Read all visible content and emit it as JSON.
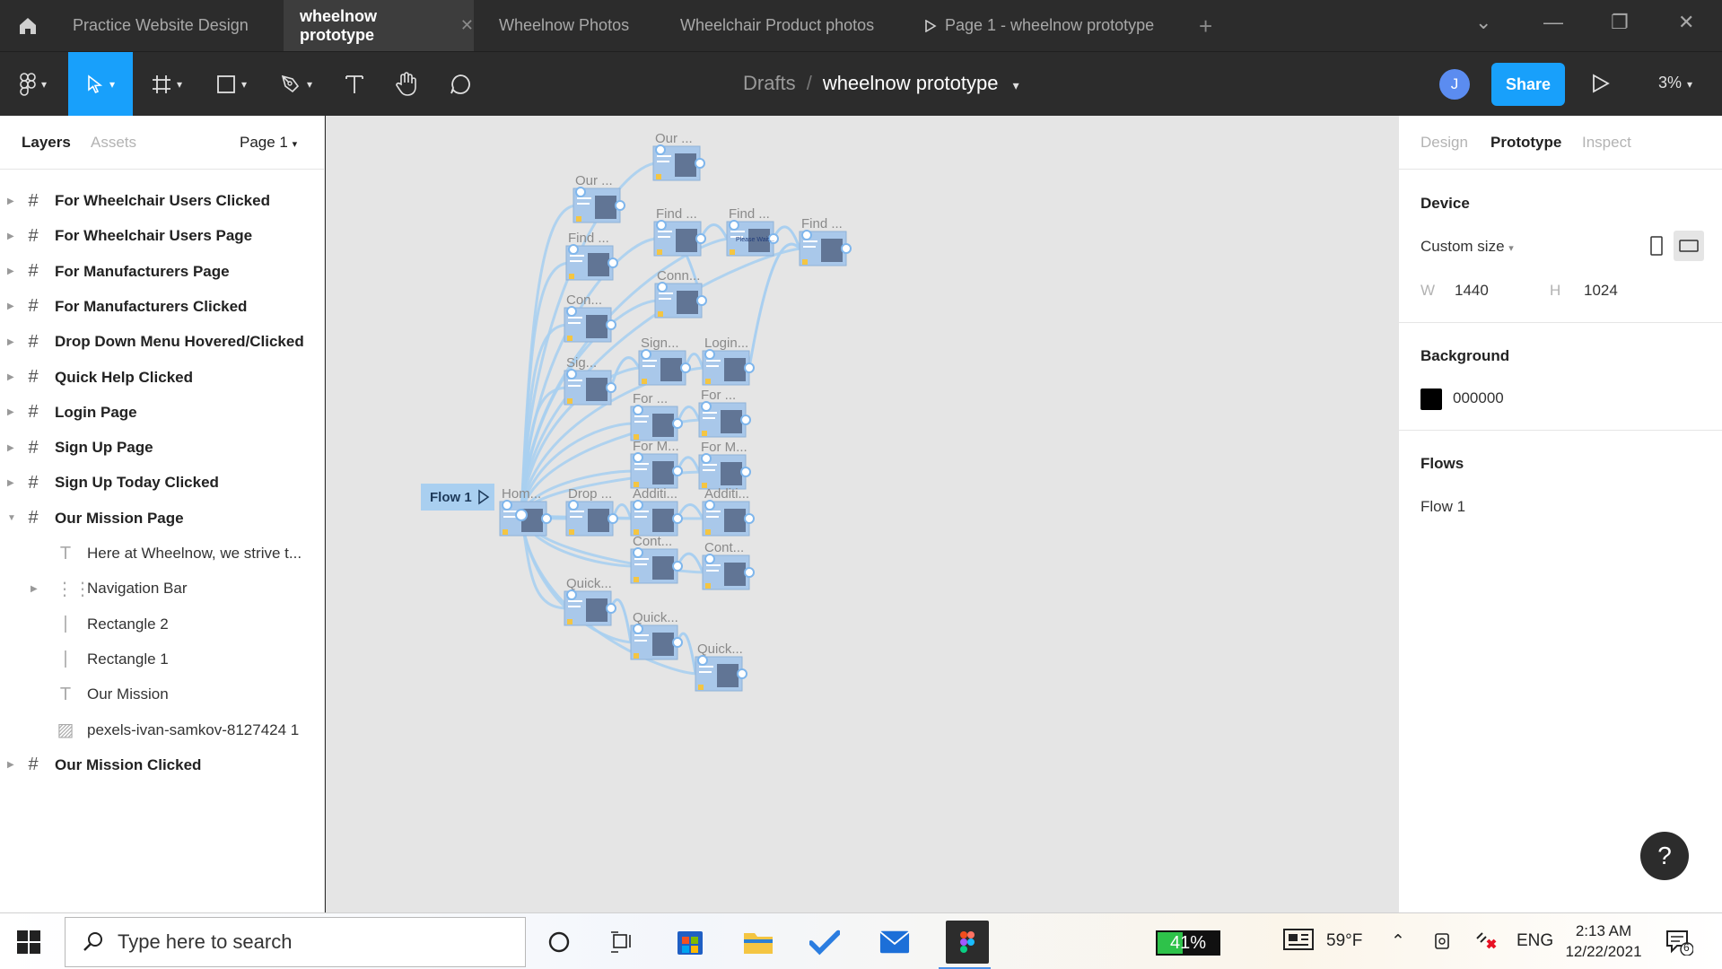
{
  "tabs": [
    {
      "label": "Practice Website Design"
    },
    {
      "label": "wheelnow prototype"
    },
    {
      "label": "Wheelnow Photos"
    },
    {
      "label": "Wheelchair Product photos"
    },
    {
      "label": "Page 1 - wheelnow prototype"
    }
  ],
  "toolbar": {
    "breadcrumb_project": "Drafts",
    "breadcrumb_sep": "/",
    "file_name": "wheelnow prototype",
    "avatar_initial": "J",
    "share_label": "Share",
    "zoom": "3%"
  },
  "left_panel": {
    "tab_layers": "Layers",
    "tab_assets": "Assets",
    "page_select": "Page 1",
    "layers": [
      {
        "label": "For Wheelchair Users Clicked",
        "type": "frame",
        "level": 0,
        "expanded": false
      },
      {
        "label": "For Wheelchair Users Page",
        "type": "frame",
        "level": 0,
        "expanded": false
      },
      {
        "label": "For Manufacturers Page",
        "type": "frame",
        "level": 0,
        "expanded": false
      },
      {
        "label": "For Manufacturers Clicked",
        "type": "frame",
        "level": 0,
        "expanded": false
      },
      {
        "label": "Drop Down Menu Hovered/Clicked",
        "type": "frame",
        "level": 0,
        "expanded": false
      },
      {
        "label": "Quick Help Clicked",
        "type": "frame",
        "level": 0,
        "expanded": false
      },
      {
        "label": "Login Page",
        "type": "frame",
        "level": 0,
        "expanded": false
      },
      {
        "label": "Sign Up Page",
        "type": "frame",
        "level": 0,
        "expanded": false
      },
      {
        "label": "Sign Up Today Clicked",
        "type": "frame",
        "level": 0,
        "expanded": false
      },
      {
        "label": "Our Mission Page",
        "type": "frame",
        "level": 0,
        "expanded": true
      },
      {
        "label": "Here at Wheelnow, we strive t...",
        "type": "text",
        "level": 1
      },
      {
        "label": "Navigation Bar",
        "type": "group",
        "level": 1
      },
      {
        "label": "Rectangle 2",
        "type": "line",
        "level": 1
      },
      {
        "label": "Rectangle 1",
        "type": "line",
        "level": 1
      },
      {
        "label": "Our Mission",
        "type": "text",
        "level": 1
      },
      {
        "label": "pexels-ivan-samkov-8127424 1",
        "type": "image",
        "level": 1
      },
      {
        "label": "Our Mission Clicked",
        "type": "frame",
        "level": 0,
        "expanded": false
      }
    ]
  },
  "canvas": {
    "flow_label": "Flow 1",
    "frame_labels": [
      "Our ...",
      "Our ...",
      "Find ...",
      "Find ...",
      "Find ...",
      "Find ...",
      "Con...",
      "Conn...",
      "Sig...",
      "Sign...",
      "Login...",
      "For ...",
      "For ...",
      "For M...",
      "For M...",
      "Hom...",
      "Drop ...",
      "Additi...",
      "Additi...",
      "Cont...",
      "Cont...",
      "Quick...",
      "Quick...",
      "Quick..."
    ],
    "frame_inner_text": "Please Wait..."
  },
  "right_panel": {
    "tab_design": "Design",
    "tab_prototype": "Prototype",
    "tab_inspect": "Inspect",
    "device_title": "Device",
    "device_value": "Custom size",
    "width_label": "W",
    "width_value": "1440",
    "height_label": "H",
    "height_value": "1024",
    "background_title": "Background",
    "background_value": "000000",
    "flows_title": "Flows",
    "flow_item": "Flow 1"
  },
  "help_label": "?",
  "taskbar": {
    "search_placeholder": "Type here to search",
    "battery": "41%",
    "battery_level": 0.41,
    "weather": "59°F",
    "language": "ENG",
    "time": "2:13 AM",
    "date": "12/22/2021",
    "notification_count": "6"
  },
  "colors": {
    "figma_blue": "#18a0fb",
    "canvas_bg": "#e5e5e5",
    "connector": "#a9cff0",
    "dark_bar": "#2c2c2c"
  }
}
